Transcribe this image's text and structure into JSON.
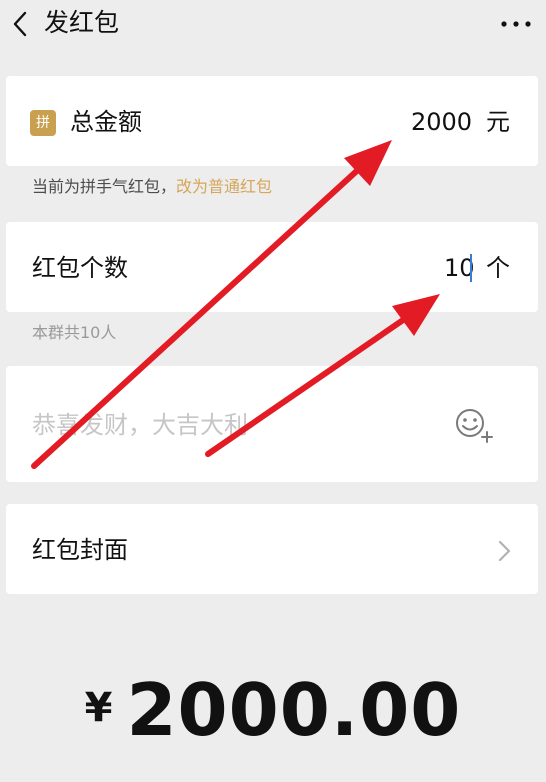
{
  "header": {
    "title": "发红包",
    "back_icon": "chevron-left-icon",
    "more_icon": "more-dots-icon"
  },
  "amount_row": {
    "badge": "拼",
    "label": "总金额",
    "value": "2000",
    "unit": "元"
  },
  "packet_type_hint": {
    "text": "当前为拼手气红包，",
    "link": "改为普通红包"
  },
  "count_row": {
    "label": "红包个数",
    "value": "10",
    "unit": "个"
  },
  "group_hint": "本群共10人",
  "blessing": {
    "placeholder": "恭喜发财，大吉大利",
    "emoji_icon": "emoji-add-icon"
  },
  "cover_row": {
    "label": "红包封面",
    "chevron_icon": "chevron-right-icon"
  },
  "total": {
    "currency": "¥",
    "amount": "2000.00"
  },
  "colors": {
    "background": "#ededed",
    "card": "#ffffff",
    "badge": "#c9a04f",
    "link": "#d6a65a",
    "annotation_arrows": "#e21b25"
  }
}
